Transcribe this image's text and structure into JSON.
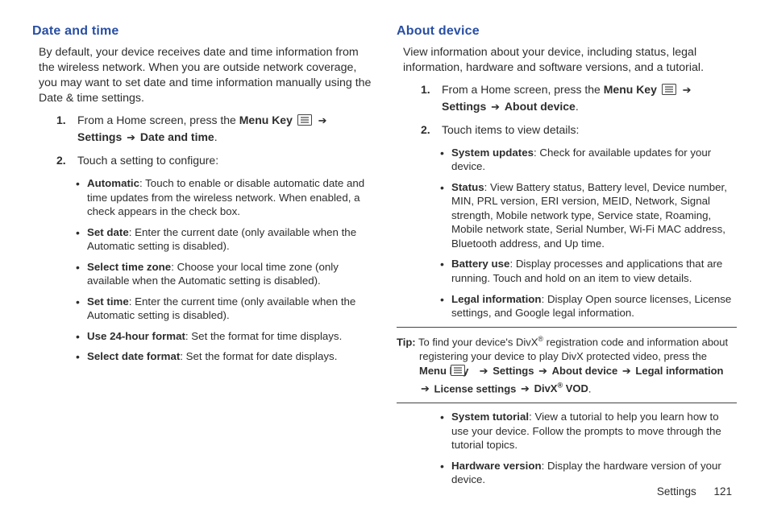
{
  "left": {
    "heading": "Date and time",
    "intro": "By default, your device receives date and time information from the wireless network.  When you are outside network coverage, you may want to set date and time information manually using the Date & time settings.",
    "step1_a": "From a Home screen, press the ",
    "step1_menu": "Menu Key",
    "step1_settings": "Settings",
    "step1_target": "Date and time",
    "step2": "Touch a setting to configure:",
    "bullets": [
      {
        "term": "Automatic",
        "desc": ": Touch to enable or disable automatic date and time updates from the wireless network. When enabled, a check appears in the check box."
      },
      {
        "term": "Set date",
        "desc": ": Enter the current date (only available when the Automatic setting is disabled)."
      },
      {
        "term": "Select time zone",
        "desc": ": Choose your local time zone (only available when the Automatic setting is disabled)."
      },
      {
        "term": "Set time",
        "desc": ": Enter the current time (only available when the Automatic setting is disabled)."
      },
      {
        "term": "Use 24-hour format",
        "desc": ": Set the format for time displays."
      },
      {
        "term": "Select date format",
        "desc": ": Set the format for date displays."
      }
    ]
  },
  "right": {
    "heading": "About device",
    "intro": "View information about your device, including status, legal information, hardware and software versions, and a tutorial.",
    "step1_a": "From a Home screen, press the ",
    "step1_menu": "Menu Key",
    "step1_settings": "Settings",
    "step1_target": "About device",
    "step2": "Touch items to view details:",
    "bullets1": [
      {
        "term": "System updates",
        "desc": ": Check for available updates for your device."
      },
      {
        "term": "Status",
        "desc": ": View Battery status, Battery level, Device number, MIN, PRL version, ERI version, MEID, Network, Signal strength, Mobile network type, Service state, Roaming, Mobile network state, Serial Number, Wi-Fi MAC address, Bluetooth address, and Up time."
      },
      {
        "term": "Battery use",
        "desc": ": Display processes and applications that are running. Touch and hold on an item to view details."
      },
      {
        "term": "Legal information",
        "desc": ": Display Open source licenses, License settings, and Google legal information."
      }
    ],
    "tip_label": "Tip:",
    "tip_a": " To find your device's DivX",
    "tip_b": " registration code and information about registering your device to play DivX protected video, press the ",
    "tip_menu": "Menu Key",
    "tip_settings": "Settings",
    "tip_about": "About device",
    "tip_legal": "Legal information",
    "tip_license": "License settings",
    "tip_divx": "DivX",
    "tip_vod": " VOD",
    "bullets2": [
      {
        "term": "System tutorial",
        "desc": ": View a tutorial to help you learn how to use your device. Follow the prompts to move through the tutorial topics."
      },
      {
        "term": "Hardware version",
        "desc": ": Display the hardware version of your device."
      }
    ]
  },
  "footer": {
    "section": "Settings",
    "page": "121"
  },
  "glyphs": {
    "arrow": "➔",
    "reg": "®"
  }
}
